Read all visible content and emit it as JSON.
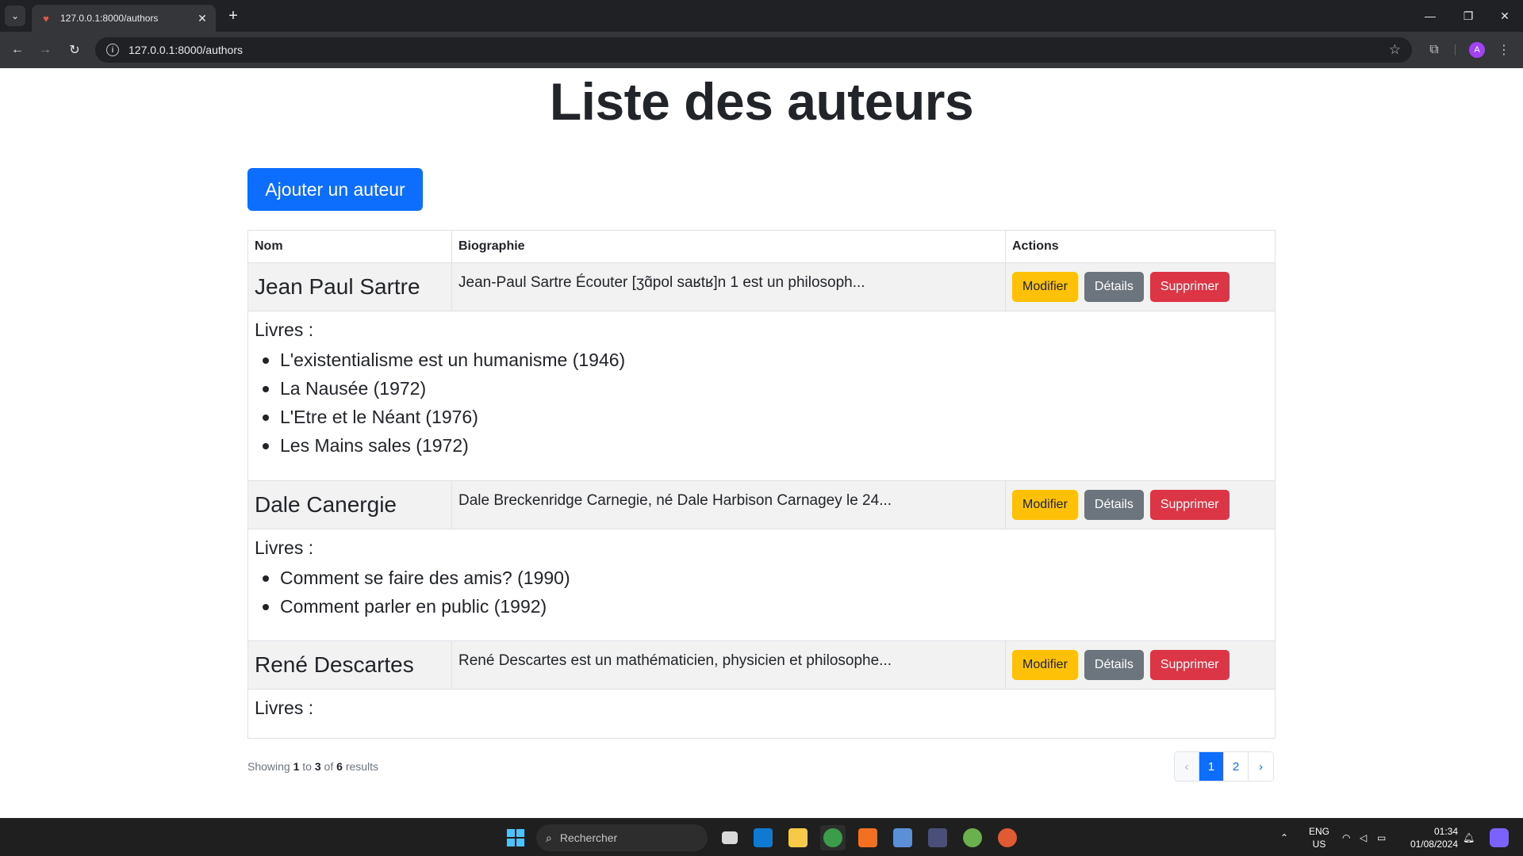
{
  "browser": {
    "tab_title": "127.0.0.1:8000/authors",
    "tab_close": "✕",
    "new_tab": "+",
    "url": "127.0.0.1:8000/authors",
    "avatar_letter": "A"
  },
  "page": {
    "title": "Liste des auteurs",
    "add_button": "Ajouter un auteur",
    "table": {
      "headers": {
        "nom": "Nom",
        "bio": "Biographie",
        "actions": "Actions"
      },
      "authors": [
        {
          "name": "Jean Paul Sartre",
          "bio": "Jean-Paul Sartre Écouter [ʒɑ̃pol saʁtʁ]n 1 est un philosoph...",
          "books_label": "Livres :",
          "books": [
            "L'existentialisme est un humanisme (1946)",
            "La Nausée (1972)",
            "L'Etre et le Néant (1976)",
            "Les Mains sales (1972)"
          ]
        },
        {
          "name": "Dale Canergie",
          "bio": "Dale Breckenridge Carnegie, né Dale Harbison Carnagey le 24...",
          "books_label": "Livres :",
          "books": [
            "Comment se faire des amis? (1990)",
            "Comment parler en public (1992)"
          ]
        },
        {
          "name": "René Descartes",
          "bio": "René Descartes est un mathématicien, physicien et philosophe...",
          "books_label": "Livres :",
          "books": []
        }
      ],
      "actions": {
        "edit": "Modifier",
        "details": "Détails",
        "delete": "Supprimer"
      }
    },
    "pagination": {
      "showing": "Showing",
      "from": "1",
      "to_word": "to",
      "to": "3",
      "of_word": "of",
      "total": "6",
      "results_word": "results",
      "prev": "‹",
      "pages": [
        "1",
        "2"
      ],
      "next": "›",
      "active_page": "1"
    }
  },
  "taskbar": {
    "search_placeholder": "Rechercher",
    "lang_line1": "ENG",
    "lang_line2": "US",
    "time": "01:34",
    "date": "01/08/2024"
  },
  "colors": {
    "primary": "#0d6efd",
    "warning": "#ffc107",
    "secondary": "#6c757d",
    "danger": "#dc3545"
  }
}
